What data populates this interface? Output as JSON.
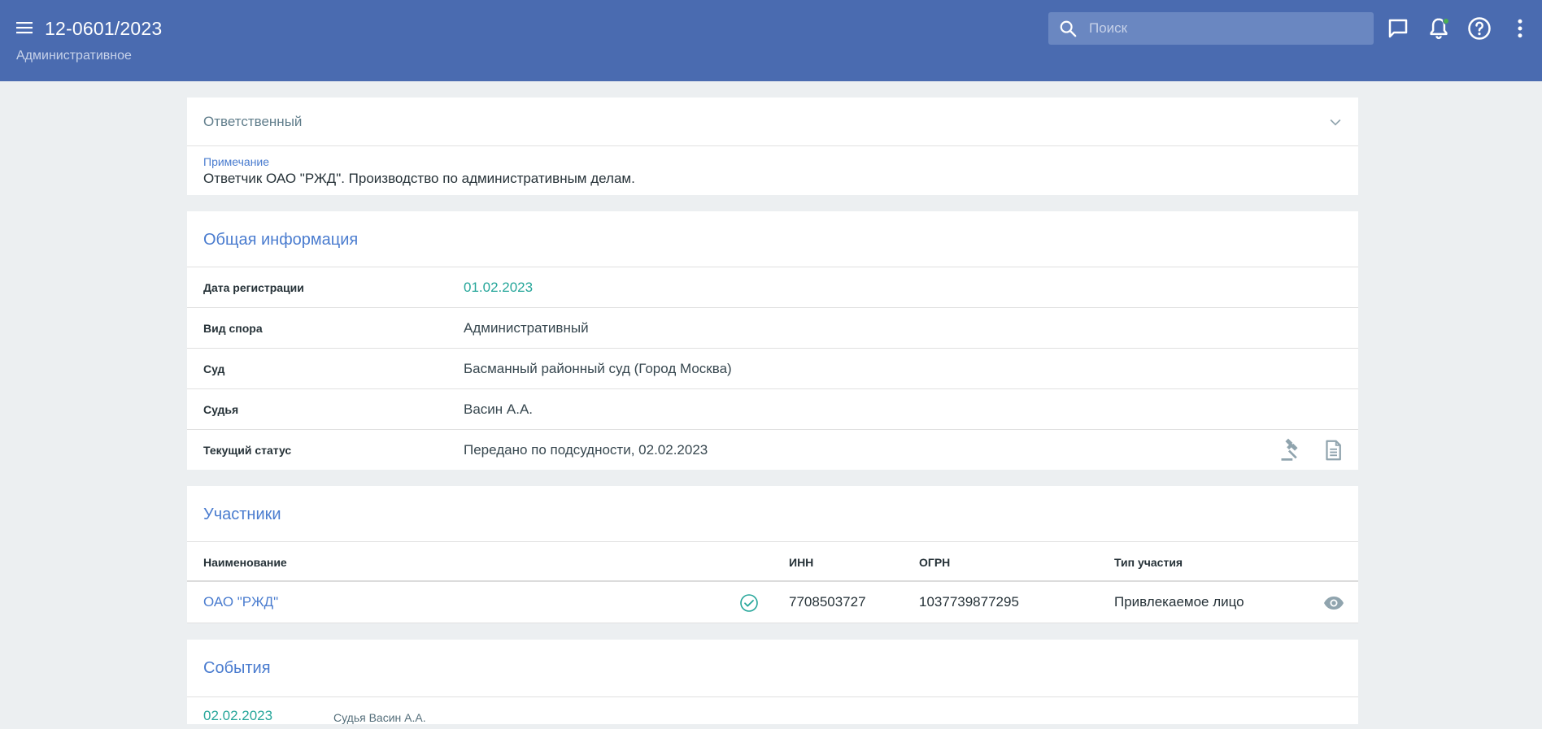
{
  "header": {
    "case_number": "12-0601/2023",
    "case_type": "Административное",
    "search_placeholder": "Поиск",
    "menu_icon": "hamburger-icon",
    "icons": [
      "chat-icon",
      "bell-icon",
      "help-icon",
      "more-vertical-icon"
    ],
    "notification_dot_color": "#4caf50",
    "bar_color": "#4a6bb0"
  },
  "responsible": {
    "label": "Ответственный",
    "note_label": "Примечание",
    "note_text": "Ответчик ОАО \"РЖД\". Производство по административным делам."
  },
  "general": {
    "title": "Общая информация",
    "rows": [
      {
        "label": "Дата регистрации",
        "value": "01.02.2023"
      },
      {
        "label": "Вид спора",
        "value": "Административный"
      },
      {
        "label": "Суд",
        "value": "Басманный районный суд (Город Москва)"
      },
      {
        "label": "Судья",
        "value": "Васин А.А."
      },
      {
        "label": "Текущий статус",
        "value": "Передано по подсудности, 02.02.2023"
      }
    ],
    "status_icons": [
      "gavel-icon",
      "document-icon"
    ]
  },
  "participants": {
    "title": "Участники",
    "columns": [
      "Наименование",
      "ИНН",
      "ОГРН",
      "Тип участия"
    ],
    "rows": [
      {
        "name": "ОАО \"РЖД\"",
        "inn": "7708503727",
        "ogrn": "1037739877295",
        "type": "Привлекаемое лицо",
        "verified": true
      }
    ]
  },
  "events": {
    "title": "События",
    "items": [
      {
        "date": "02.02.2023",
        "text": "Судья Васин А.А."
      }
    ]
  },
  "colors": {
    "accent_blue": "#4a7ccf",
    "accent_green": "#26a69a",
    "background": "#eceff1"
  }
}
